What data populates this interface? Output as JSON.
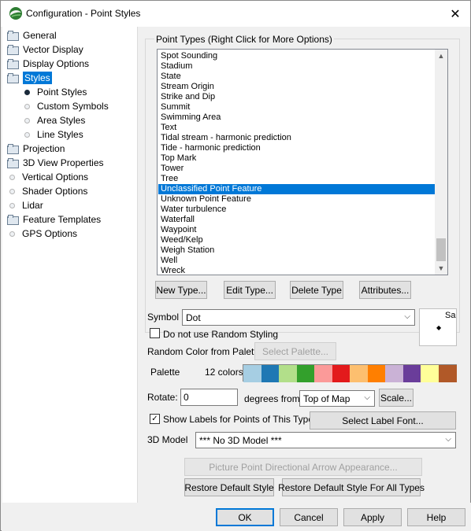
{
  "window": {
    "title": "Configuration - Point Styles",
    "icon": "globe-app-icon",
    "close_icon": "close-icon"
  },
  "tree": [
    {
      "label": "General",
      "type": "folder"
    },
    {
      "label": "Vector Display",
      "type": "folder"
    },
    {
      "label": "Display Options",
      "type": "folder"
    },
    {
      "label": "Styles",
      "type": "folder-open",
      "selected": true
    },
    {
      "label": "Point Styles",
      "type": "child",
      "active": true
    },
    {
      "label": "Custom Symbols",
      "type": "child"
    },
    {
      "label": "Area Styles",
      "type": "child"
    },
    {
      "label": "Line Styles",
      "type": "child"
    },
    {
      "label": "Projection",
      "type": "folder"
    },
    {
      "label": "3D View Properties",
      "type": "folder"
    },
    {
      "label": "Vertical Options",
      "type": "leaf"
    },
    {
      "label": "Shader Options",
      "type": "leaf"
    },
    {
      "label": "Lidar",
      "type": "leaf"
    },
    {
      "label": "Feature Templates",
      "type": "folder"
    },
    {
      "label": "GPS Options",
      "type": "leaf"
    }
  ],
  "point_types": {
    "group_label": "Point Types (Right Click for More Options)",
    "items": [
      "Spot Sounding",
      "Stadium",
      "State",
      "Stream Origin",
      "Strike and Dip",
      "Summit",
      "Swimming Area",
      "Text",
      "Tidal stream - harmonic prediction",
      "Tide - harmonic prediction",
      "Top Mark",
      "Tower",
      "Tree",
      "Unclassified Point Feature",
      "Unknown Point Feature",
      "Water turbulence",
      "Waterfall",
      "Waypoint",
      "Weed/Kelp",
      "Weigh Station",
      "Well",
      "Wreck"
    ],
    "selected_item": "Unclassified Point Feature",
    "scroll_position": 0.93,
    "buttons": {
      "new": "New Type...",
      "edit": "Edit Type...",
      "delete": "Delete Type",
      "attributes": "Attributes..."
    }
  },
  "symbol": {
    "label": "Symbol",
    "value": "Dot",
    "preview_text": "Sa"
  },
  "random_styling": {
    "label": "Do not use Random Styling",
    "checked": false
  },
  "random_color": {
    "label": "Random Color from Palette",
    "button": "Select Palette..."
  },
  "palette": {
    "label": "Palette",
    "count_label": "12 colors",
    "colors": [
      "#a6cee3",
      "#1f78b4",
      "#b2df8a",
      "#33a02c",
      "#fb9a99",
      "#e31a1c",
      "#fdbf6f",
      "#ff7f00",
      "#cab2d6",
      "#6a3d9a",
      "#ffff99",
      "#b15928"
    ]
  },
  "rotate": {
    "label": "Rotate:",
    "value": "0",
    "degrees_label": "degrees from",
    "from_value": "Top of Map",
    "scale_button": "Scale..."
  },
  "labels": {
    "checkbox_label": "Show Labels for Points of This Type",
    "checked": true,
    "font_button": "Select Label  Font..."
  },
  "model": {
    "label": "3D Model",
    "value": "*** No 3D Model ***"
  },
  "buttons": {
    "arrow_appearance": "Picture Point Directional Arrow Appearance...",
    "restore_default": "Restore Default Style",
    "restore_all": "Restore Default Style For All Types"
  },
  "footer": {
    "ok": "OK",
    "cancel": "Cancel",
    "apply": "Apply",
    "help": "Help"
  }
}
